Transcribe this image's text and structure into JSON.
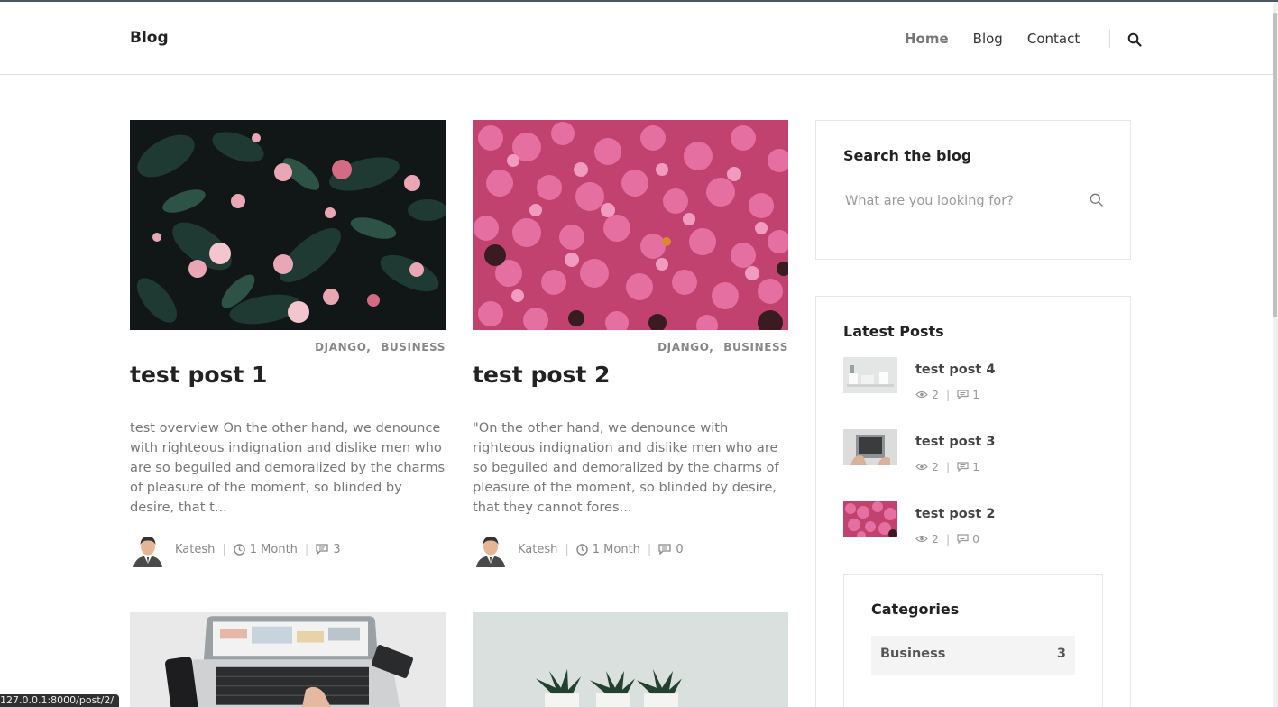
{
  "header": {
    "brand": "Blog",
    "nav": [
      {
        "label": "Home",
        "active": true
      },
      {
        "label": "Blog",
        "active": false
      },
      {
        "label": "Contact",
        "active": false
      }
    ],
    "search_icon": "search-icon"
  },
  "posts": [
    {
      "categories": [
        "DJANGO",
        "BUSINESS"
      ],
      "title": "test post 1",
      "excerpt": "test overview On the other hand, we denounce with righteous indignation and dislike men who are so beguiled and demoralized by the charms of pleasure of the moment, so blinded by desire, that t...",
      "author": "Katesh",
      "time": "1 Month",
      "comments": "3",
      "image": "dark-green-foliage-pink-camellia-flowers"
    },
    {
      "categories": [
        "DJANGO",
        "BUSINESS"
      ],
      "title": "test post 2",
      "excerpt": "\"On the other hand, we denounce with righteous indignation and dislike men who are so beguiled and demoralized by the charms of pleasure of the moment, so blinded by desire, that they cannot fores...",
      "author": "Katesh",
      "time": "1 Month",
      "comments": "0",
      "image": "pink-phlox-flower-cluster"
    },
    {
      "image": "laptop-keyboard-phone-desk-topview"
    },
    {
      "image": "succulent-pots-on-pale-background"
    }
  ],
  "sidebar": {
    "search": {
      "title": "Search the blog",
      "placeholder": "What are you looking for?"
    },
    "latest": {
      "title": "Latest Posts",
      "items": [
        {
          "title": "test post 4",
          "views": "2",
          "comments": "1",
          "image": "white-desk-items"
        },
        {
          "title": "test post 3",
          "views": "2",
          "comments": "1",
          "image": "laptop-hands"
        },
        {
          "title": "test post 2",
          "views": "2",
          "comments": "0",
          "image": "pink-flowers"
        }
      ]
    },
    "categories": {
      "title": "Categories",
      "items": [
        {
          "name": "Business",
          "count": "3"
        }
      ]
    }
  },
  "status_bar": "127.0.0.1:8000/post/2/",
  "colors": {
    "accent_dark": "#222222",
    "muted_text": "#777777",
    "border": "#e6e6e6",
    "top_line": "#4a5660"
  }
}
